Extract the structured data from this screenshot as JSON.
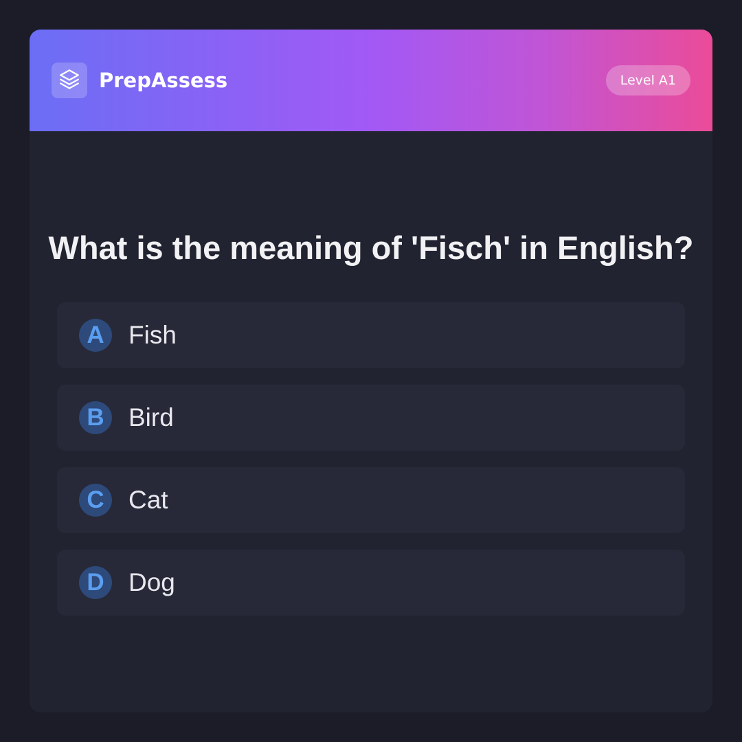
{
  "header": {
    "logo_icon": "layers-icon",
    "app_name": "PrepAssess",
    "level_badge": "Level A1"
  },
  "quiz": {
    "question": "What is the meaning of 'Fisch' in English?",
    "options": [
      {
        "letter": "A",
        "text": "Fish"
      },
      {
        "letter": "B",
        "text": "Bird"
      },
      {
        "letter": "C",
        "text": "Cat"
      },
      {
        "letter": "D",
        "text": "Dog"
      }
    ]
  },
  "colors": {
    "background": "#1b1c28",
    "card": "#212330",
    "option_bg": "#272938",
    "accent_blue": "#5b9ef0",
    "gradient_start": "#6b6ef5",
    "gradient_mid": "#a259f5",
    "gradient_end": "#eb4b98"
  }
}
